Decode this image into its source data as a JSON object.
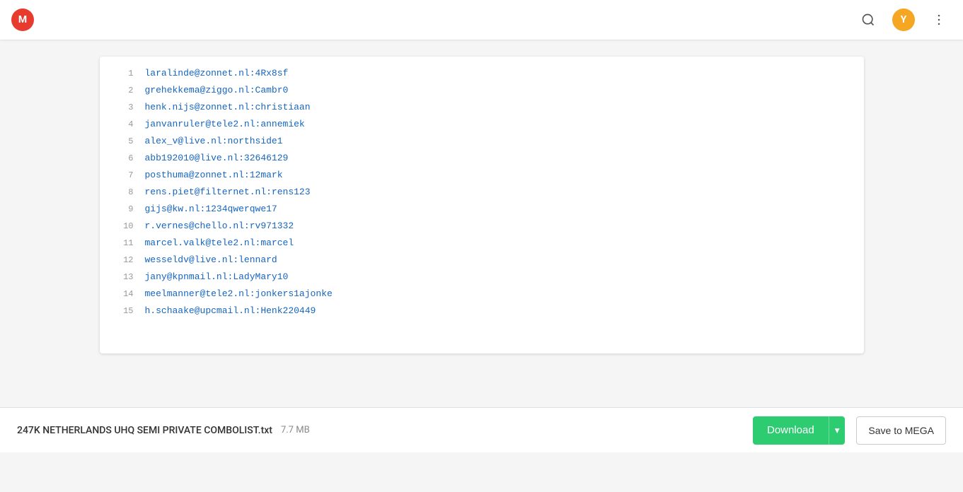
{
  "topbar": {
    "logo_label": "M",
    "user_avatar_label": "Y",
    "search_tooltip": "Search",
    "more_tooltip": "More options"
  },
  "file": {
    "name": "247K NETHERLANDS UHQ SEMI PRIVATE COMBOLIST.txt",
    "size": "7.7 MB",
    "lines": [
      {
        "num": 1,
        "content": "laralinde@zonnet.nl:4Rx8sf"
      },
      {
        "num": 2,
        "content": "grehekkema@ziggo.nl:Cambr0"
      },
      {
        "num": 3,
        "content": "henk.nijs@zonnet.nl:christiaan"
      },
      {
        "num": 4,
        "content": "janvanruler@tele2.nl:annemiek"
      },
      {
        "num": 5,
        "content": "alex_v@live.nl:northside1"
      },
      {
        "num": 6,
        "content": "abb192010@live.nl:32646129"
      },
      {
        "num": 7,
        "content": "posthuma@zonnet.nl:12mark"
      },
      {
        "num": 8,
        "content": "rens.piet@filternet.nl:rens123"
      },
      {
        "num": 9,
        "content": "gijs@kw.nl:1234qwerqwe17"
      },
      {
        "num": 10,
        "content": "r.vernes@chello.nl:rv971332"
      },
      {
        "num": 11,
        "content": "marcel.valk@tele2.nl:marcel"
      },
      {
        "num": 12,
        "content": "wesseldv@live.nl:lennard"
      },
      {
        "num": 13,
        "content": "jany@kpnmail.nl:LadyMary10"
      },
      {
        "num": 14,
        "content": "meelmanner@tele2.nl:jonkers1ajonke"
      },
      {
        "num": 15,
        "content": "h.schaake@upcmail.nl:Henk220449"
      }
    ]
  },
  "buttons": {
    "download_label": "Download",
    "save_mega_label": "Save to MEGA",
    "dropdown_chevron": "▾"
  }
}
